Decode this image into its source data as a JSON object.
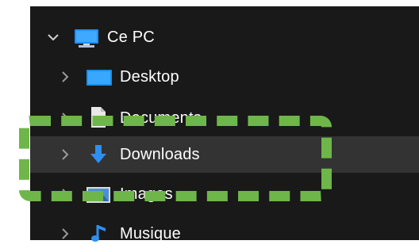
{
  "tree": {
    "items": [
      {
        "label": "Ce PC",
        "icon": "pc-icon",
        "expanded": true
      },
      {
        "label": "Desktop",
        "icon": "desktop-folder-icon"
      },
      {
        "label": "Documents",
        "icon": "documents-folder-icon"
      },
      {
        "label": "Downloads",
        "icon": "downloads-folder-icon",
        "highlighted": true
      },
      {
        "label": "Images",
        "icon": "images-folder-icon"
      },
      {
        "label": "Musique",
        "icon": "music-folder-icon"
      }
    ]
  },
  "colors": {
    "background": "#191919",
    "highlight_row": "#333333",
    "annotation_frame": "#6fb64a",
    "text": "#ffffff"
  }
}
